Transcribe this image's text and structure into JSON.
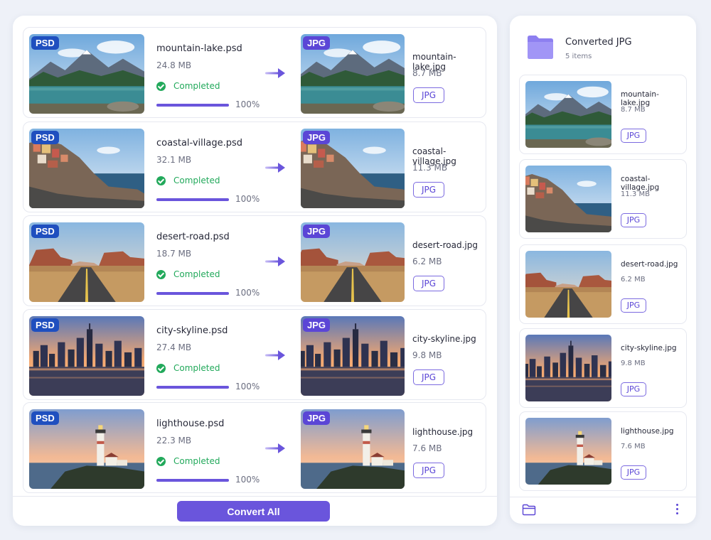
{
  "colors": {
    "accent": "#6a55dc",
    "psd_badge": "#1f4fbf",
    "jpg_badge": "#5b46d6",
    "success": "#22a95b",
    "folder": "#8d7ff0"
  },
  "conversions": [
    {
      "source_badge": "PSD",
      "source_name": "mountain-lake.psd",
      "source_size": "24.8 MB",
      "status": "Completed",
      "progress": 100,
      "progress_label": "100%",
      "target_badge": "JPG",
      "target_name": "mountain-lake.jpg",
      "target_size": "8.7 MB",
      "format": "JPG",
      "scene": "mountain"
    },
    {
      "source_badge": "PSD",
      "source_name": "coastal-village.psd",
      "source_size": "32.1 MB",
      "status": "Completed",
      "progress": 100,
      "progress_label": "100%",
      "target_badge": "JPG",
      "target_name": "coastal-village.jpg",
      "target_size": "11.3 MB",
      "format": "JPG",
      "scene": "coast"
    },
    {
      "source_badge": "PSD",
      "source_name": "desert-road.psd",
      "source_size": "18.7 MB",
      "status": "Completed",
      "progress": 100,
      "progress_label": "100%",
      "target_badge": "JPG",
      "target_name": "desert-road.jpg",
      "target_size": "6.2 MB",
      "format": "JPG",
      "scene": "desert"
    },
    {
      "source_badge": "PSD",
      "source_name": "city-skyline.psd",
      "source_size": "27.4 MB",
      "status": "Completed",
      "progress": 100,
      "progress_label": "100%",
      "target_badge": "JPG",
      "target_name": "city-skyline.jpg",
      "target_size": "9.8 MB",
      "format": "JPG",
      "scene": "city"
    },
    {
      "source_badge": "PSD",
      "source_name": "lighthouse.psd",
      "source_size": "22.3 MB",
      "status": "Completed",
      "progress": 100,
      "progress_label": "100%",
      "target_badge": "JPG",
      "target_name": "lighthouse.jpg",
      "target_size": "7.6 MB",
      "format": "JPG",
      "scene": "lighthouse"
    }
  ],
  "actions": {
    "convert_all_label": "Convert All"
  },
  "output_folder": {
    "title": "Converted JPG",
    "count_label": "5 items",
    "files": [
      {
        "name": "mountain-lake.jpg",
        "size": "8.7 MB",
        "format": "JPG",
        "scene": "mountain"
      },
      {
        "name": "coastal-village.jpg",
        "size": "11.3 MB",
        "format": "JPG",
        "scene": "coast"
      },
      {
        "name": "desert-road.jpg",
        "size": "6.2 MB",
        "format": "JPG",
        "scene": "desert"
      },
      {
        "name": "city-skyline.jpg",
        "size": "9.8 MB",
        "format": "JPG",
        "scene": "city"
      },
      {
        "name": "lighthouse.jpg",
        "size": "7.6 MB",
        "format": "JPG",
        "scene": "lighthouse"
      }
    ]
  },
  "icons": {
    "arrow": "arrow-right-icon",
    "status": "check-circle-icon",
    "folder": "folder-icon",
    "more": "more-vertical-icon"
  }
}
